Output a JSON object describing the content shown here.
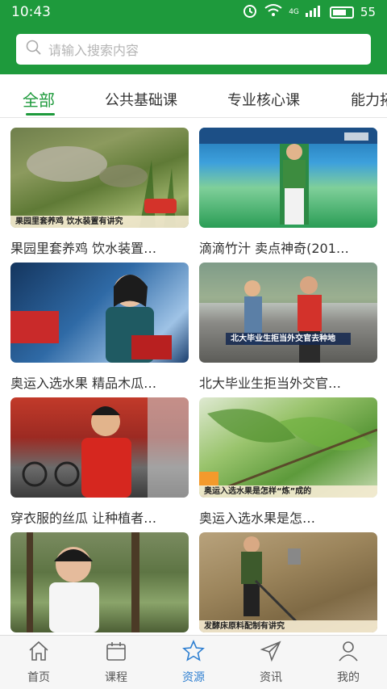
{
  "status": {
    "time": "10:43",
    "network": "4G",
    "battery": "55"
  },
  "search": {
    "placeholder": "请输入搜索内容"
  },
  "tabs": [
    {
      "label": "全部"
    },
    {
      "label": "公共基础课"
    },
    {
      "label": "专业核心课"
    },
    {
      "label": "能力拓"
    }
  ],
  "videos": [
    {
      "title": "果园里套养鸡 饮水装置…",
      "banner": "果园里套养鸡 饮水装置有讲究"
    },
    {
      "title": "滴滴竹汁 卖点神奇(201…",
      "banner": ""
    },
    {
      "title": "奥运入选水果 精品木瓜…",
      "banner": ""
    },
    {
      "title": "北大毕业生拒当外交官…",
      "banner": "北大毕业生拒当外交官去种地"
    },
    {
      "title": "穿衣服的丝瓜 让种植者…",
      "banner": ""
    },
    {
      "title": "奥运入选水果是怎…",
      "banner": "奥运入选水果是怎样“炼”成的"
    },
    {
      "title": "",
      "banner": ""
    },
    {
      "title": "",
      "banner": "发酵床原料配制有讲究"
    }
  ],
  "tabbar": [
    {
      "label": "首页",
      "icon": "home-icon"
    },
    {
      "label": "课程",
      "icon": "calendar-icon"
    },
    {
      "label": "资源",
      "icon": "star-icon"
    },
    {
      "label": "资讯",
      "icon": "send-icon"
    },
    {
      "label": "我的",
      "icon": "person-icon"
    }
  ],
  "colors": {
    "brand_green": "#1e9a3c",
    "active_blue": "#2e7fd1"
  }
}
